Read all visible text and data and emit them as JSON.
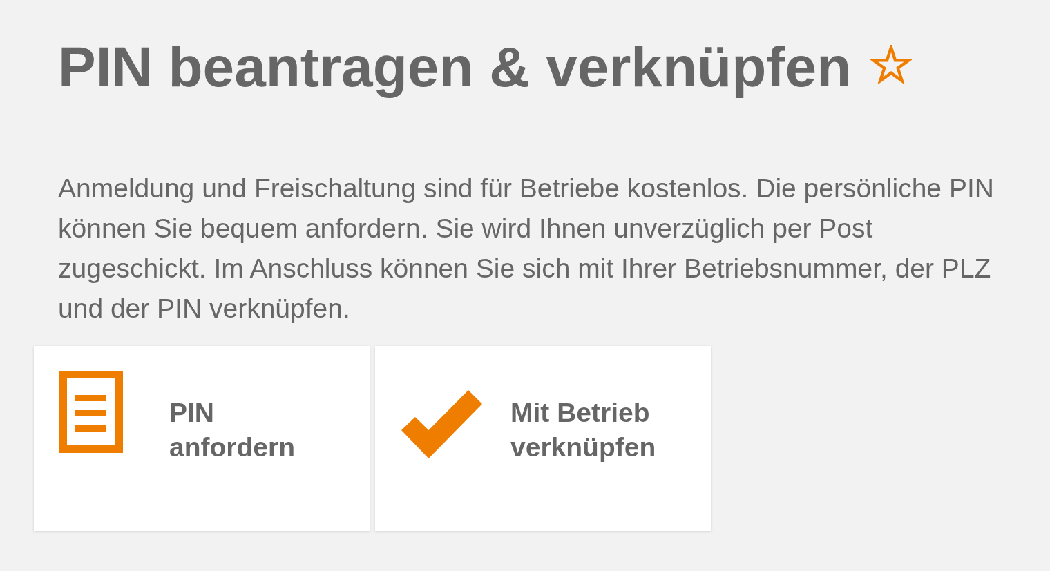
{
  "page": {
    "title": "PIN beantragen & verknüpfen",
    "favorite": false,
    "intro": "Anmeldung und Freischaltung sind für Betriebe kostenlos. Die persönliche PIN können Sie bequem anfordern. Sie wird Ihnen unverzüglich per Post zugeschickt. Im Anschluss können Sie sich mit Ihrer Betriebsnummer, der PLZ und der PIN verknüpfen.",
    "actions": [
      {
        "kind": "document",
        "label": "PIN anfordern"
      },
      {
        "kind": "check",
        "label": "Mit Betrieb verknüpfen"
      }
    ]
  }
}
